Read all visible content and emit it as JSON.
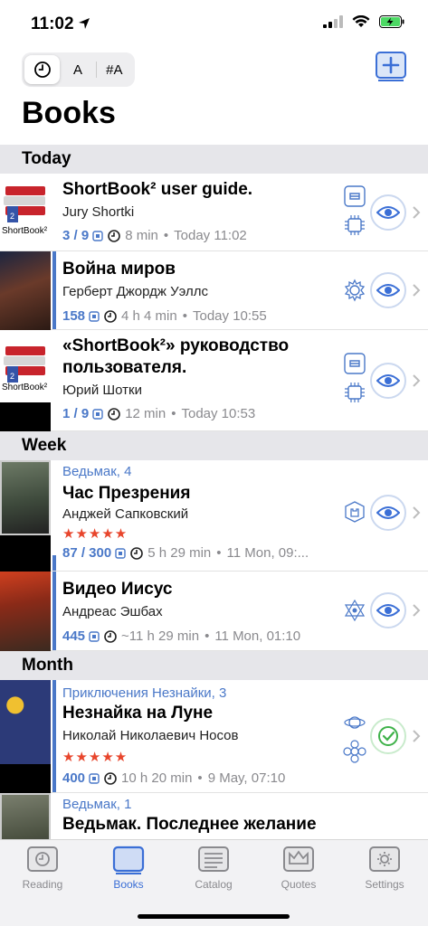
{
  "status_bar": {
    "time": "11:02"
  },
  "toolbar": {
    "sort_options": [
      "A",
      "#A"
    ],
    "title": "Books"
  },
  "sections": [
    {
      "label": "Today"
    },
    {
      "label": "Week"
    },
    {
      "label": "Month"
    }
  ],
  "books": [
    {
      "series": "",
      "title": "ShortBook² user guide.",
      "author": "Jury Shortki",
      "stars": "",
      "pages": "3 / 9",
      "duration": "8 min",
      "date": "Today 11:02",
      "cover_label": "ShortBook²"
    },
    {
      "series": "",
      "title": "Война миров",
      "author": "Герберт Джордж Уэллс",
      "stars": "",
      "pages": "158",
      "duration": "4 h 4 min",
      "date": "Today 10:55",
      "cover_label": ""
    },
    {
      "series": "",
      "title": "«ShortBook²» руководство пользователя.",
      "author": "Юрий Шотки",
      "stars": "",
      "pages": "1 / 9",
      "duration": "12 min",
      "date": "Today 10:53",
      "cover_label": "ShortBook²"
    },
    {
      "series": "Ведьмак, 4",
      "title": "Час Презрения",
      "author": "Анджей Сапковский",
      "stars": "★★★★★",
      "pages": "87 / 300",
      "duration": "5 h 29 min",
      "date": "11 Mon, 09:...",
      "cover_label": ""
    },
    {
      "series": "",
      "title": "Видео Иисус",
      "author": "Андреас Эшбах",
      "stars": "",
      "pages": "445",
      "duration": "~11 h 29 min",
      "date": "11 Mon, 01:10",
      "cover_label": ""
    },
    {
      "series": "Приключения Незнайки, 3",
      "title": "Незнайка на Луне",
      "author": "Николай Николаевич Носов",
      "stars": "★★★★★",
      "pages": "400",
      "duration": "10 h 20 min",
      "date": "9 May, 07:10",
      "cover_label": ""
    },
    {
      "series": "Ведьмак, 1",
      "title": "Ведьмак. Последнее желание",
      "author": "",
      "stars": "",
      "pages": "",
      "duration": "",
      "date": "",
      "cover_label": ""
    }
  ],
  "tabs": [
    {
      "label": "Reading"
    },
    {
      "label": "Books"
    },
    {
      "label": "Catalog"
    },
    {
      "label": "Quotes"
    },
    {
      "label": "Settings"
    }
  ],
  "colors": {
    "accent": "#3b6fd6",
    "section_bg": "#e6e6ea",
    "star": "#e8452c",
    "done": "#3fb24a"
  }
}
